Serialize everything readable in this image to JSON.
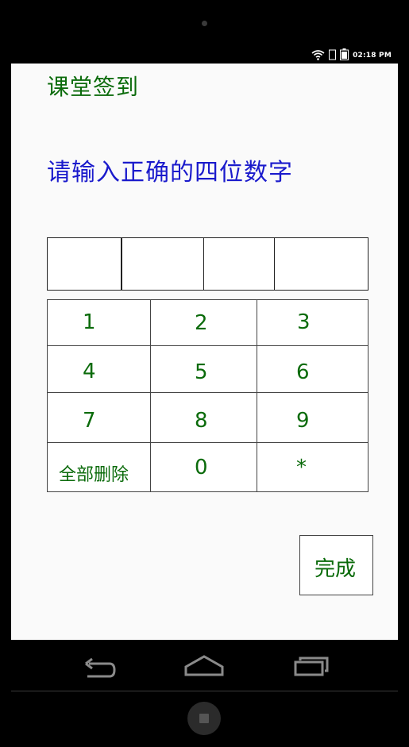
{
  "status_bar": {
    "time": "02:18 PM",
    "icons": [
      "wifi-icon",
      "signal-icon",
      "battery-icon"
    ]
  },
  "app": {
    "title": "课堂签到",
    "prompt": "请输入正确的四位数字"
  },
  "code_inputs": [
    "",
    "",
    "",
    ""
  ],
  "keypad": {
    "k1": "1",
    "k2": "2",
    "k3": "3",
    "k4": "4",
    "k5": "5",
    "k6": "6",
    "k7": "7",
    "k8": "8",
    "k9": "9",
    "clear_all": "全部删除",
    "k0": "0",
    "star": "*"
  },
  "done_label": "完成",
  "colors": {
    "title_green": "#0b6b0b",
    "prompt_blue": "#1a1acc",
    "screen_bg": "#fafafa",
    "bezel": "#000000"
  },
  "nav_bar": {
    "icons": [
      "back-icon",
      "home-icon",
      "recent-apps-icon"
    ]
  }
}
